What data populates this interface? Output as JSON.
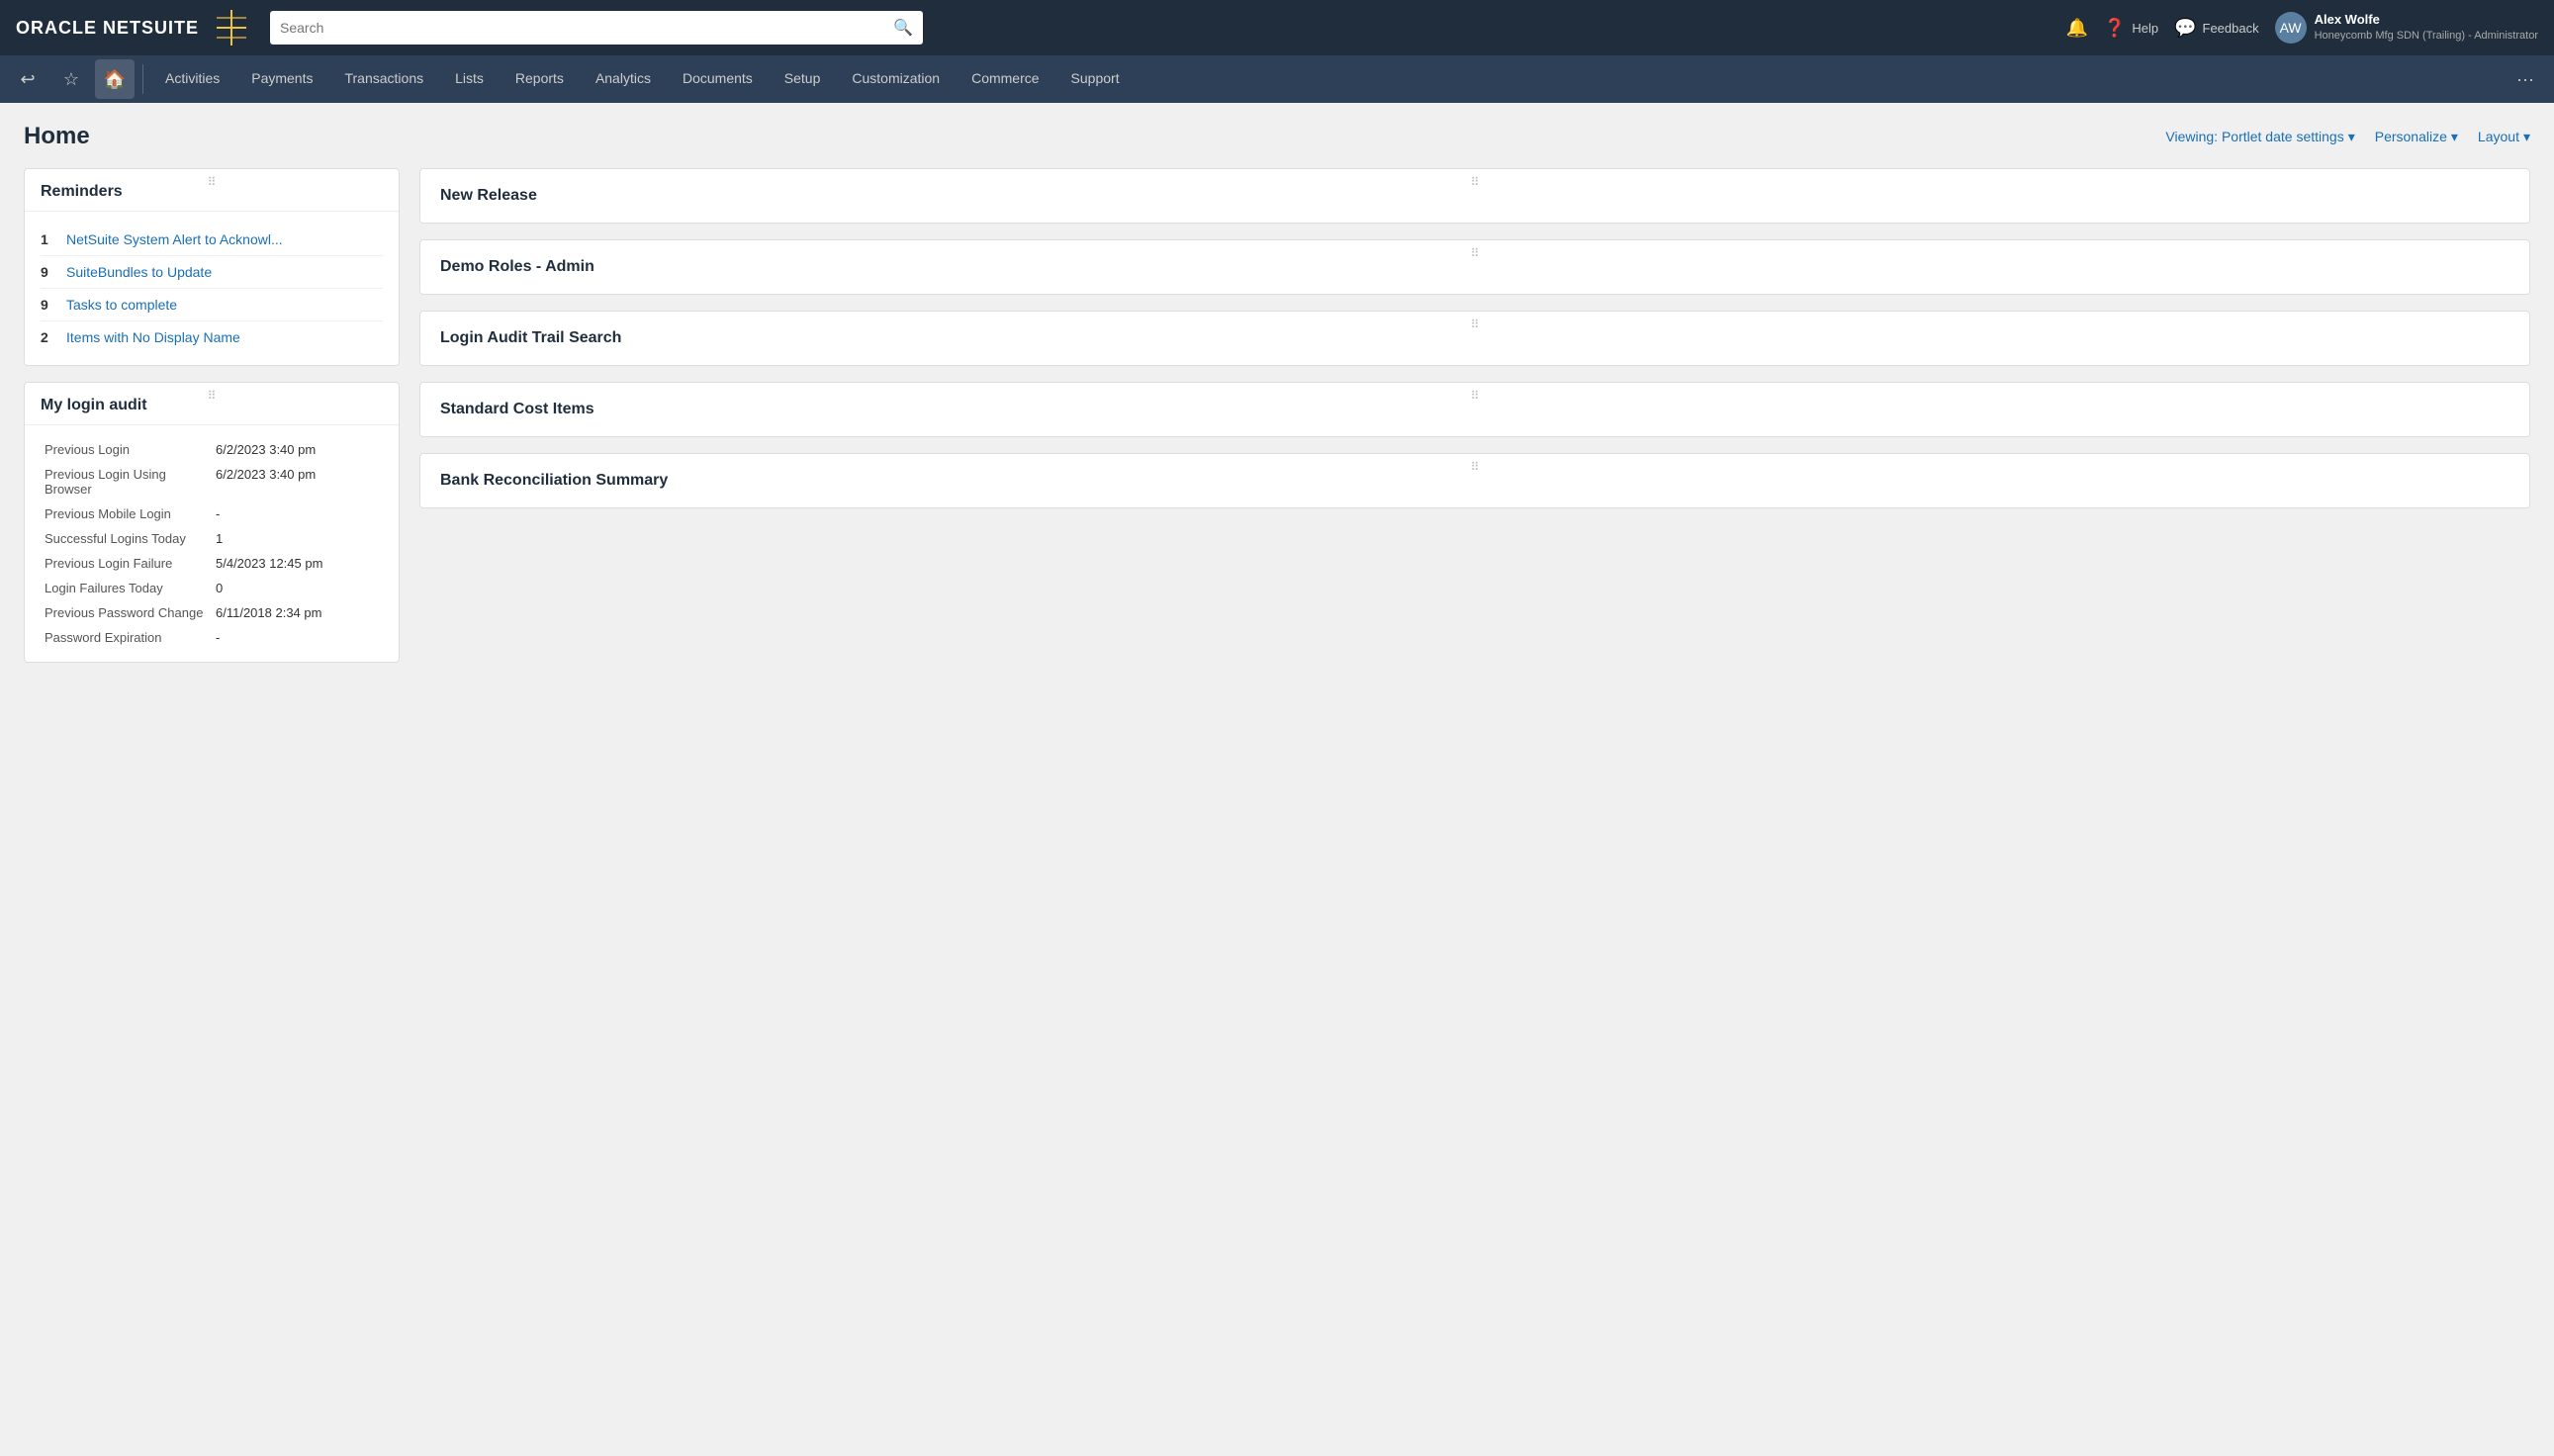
{
  "topbar": {
    "logo_text": "ORACLE NETSUITE",
    "logo_icon": "⛉",
    "search_placeholder": "Search",
    "actions": {
      "help": "Help",
      "feedback": "Feedback"
    },
    "user": {
      "name": "Alex Wolfe",
      "sub": "Honeycomb Mfg SDN (Trailing) - Administrator",
      "initials": "AW"
    }
  },
  "navbar": {
    "items": [
      {
        "label": "Activities",
        "active": false
      },
      {
        "label": "Payments",
        "active": false
      },
      {
        "label": "Transactions",
        "active": false
      },
      {
        "label": "Lists",
        "active": false
      },
      {
        "label": "Reports",
        "active": false
      },
      {
        "label": "Analytics",
        "active": false
      },
      {
        "label": "Documents",
        "active": false
      },
      {
        "label": "Setup",
        "active": false
      },
      {
        "label": "Customization",
        "active": false
      },
      {
        "label": "Commerce",
        "active": false
      },
      {
        "label": "Support",
        "active": false
      }
    ]
  },
  "page": {
    "title": "Home",
    "viewing_label": "Viewing: Portlet date settings",
    "personalize_label": "Personalize",
    "layout_label": "Layout"
  },
  "reminders": {
    "title": "Reminders",
    "items": [
      {
        "count": "1",
        "label": "NetSuite System Alert to Acknowl..."
      },
      {
        "count": "9",
        "label": "SuiteBundles to Update"
      },
      {
        "count": "9",
        "label": "Tasks to complete"
      },
      {
        "count": "2",
        "label": "Items with No Display Name"
      }
    ]
  },
  "login_audit": {
    "title": "My login audit",
    "rows": [
      {
        "label": "Previous Login",
        "value": "6/2/2023 3:40 pm"
      },
      {
        "label": "Previous Login Using Browser",
        "value": "6/2/2023 3:40 pm"
      },
      {
        "label": "Previous Mobile Login",
        "value": "-"
      },
      {
        "label": "Successful Logins Today",
        "value": "1"
      },
      {
        "label": "Previous Login Failure",
        "value": "5/4/2023 12:45 pm"
      },
      {
        "label": "Login Failures Today",
        "value": "0"
      },
      {
        "label": "Previous Password Change",
        "value": "6/11/2018 2:34 pm"
      },
      {
        "label": "Password Expiration",
        "value": "-"
      }
    ]
  },
  "right_portlets": [
    {
      "title": "New Release"
    },
    {
      "title": "Demo Roles - Admin"
    },
    {
      "title": "Login Audit Trail Search"
    },
    {
      "title": "Standard Cost Items"
    },
    {
      "title": "Bank Reconciliation Summary"
    }
  ]
}
